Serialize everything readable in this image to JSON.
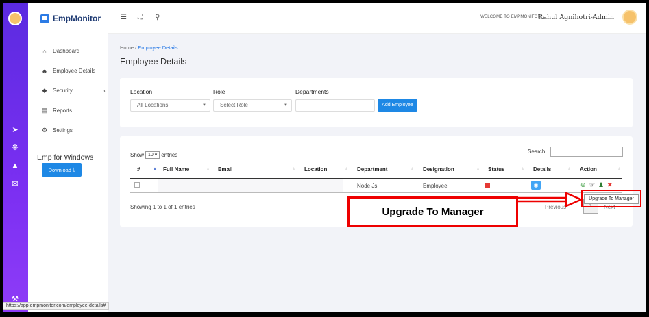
{
  "app": {
    "brand": "EmpMonitor",
    "welcome": "WELCOME TO EMPMONITOR",
    "user": "Rahul Agnihotri-Admin"
  },
  "sidebar": {
    "items": [
      {
        "label": "Dashboard",
        "icon": "home-icon"
      },
      {
        "label": "Employee Details",
        "icon": "users-icon"
      },
      {
        "label": "Security",
        "icon": "shield-icon"
      },
      {
        "label": "Reports",
        "icon": "report-icon"
      },
      {
        "label": "Settings",
        "icon": "gear-icon"
      }
    ],
    "emp_windows": "Emp for Windows",
    "download": "Download"
  },
  "breadcrumb": {
    "home": "Home",
    "separator": "/",
    "current": "Employee Details"
  },
  "page_title": "Employee Details",
  "filters": {
    "location_label": "Location",
    "location_value": "All Locations",
    "role_label": "Role",
    "role_value": "Select Role",
    "departments_label": "Departments",
    "departments_value": "",
    "add_button": "Add Employee"
  },
  "table": {
    "show": "Show",
    "page_size": "10",
    "entries": "entries",
    "search_label": "Search:",
    "columns": [
      "#",
      "Full Name",
      "Email",
      "Location",
      "Department",
      "Designation",
      "Status",
      "Details",
      "Action"
    ],
    "row": {
      "department": "Node Js",
      "designation": "Employee"
    },
    "showing": "Showing 1 to 1 of 1 entries",
    "previous": "Previous",
    "page": "1",
    "next": "Next"
  },
  "tooltip": "Upgrade To Manager",
  "callout": "Upgrade To Manager",
  "status_url": "https://app.empmonitor.com/employee-details#",
  "colors": {
    "rail": "#6a2ee8",
    "primary": "#1e88e5",
    "status_inactive": "#e53935",
    "annotation": "#e00000"
  }
}
